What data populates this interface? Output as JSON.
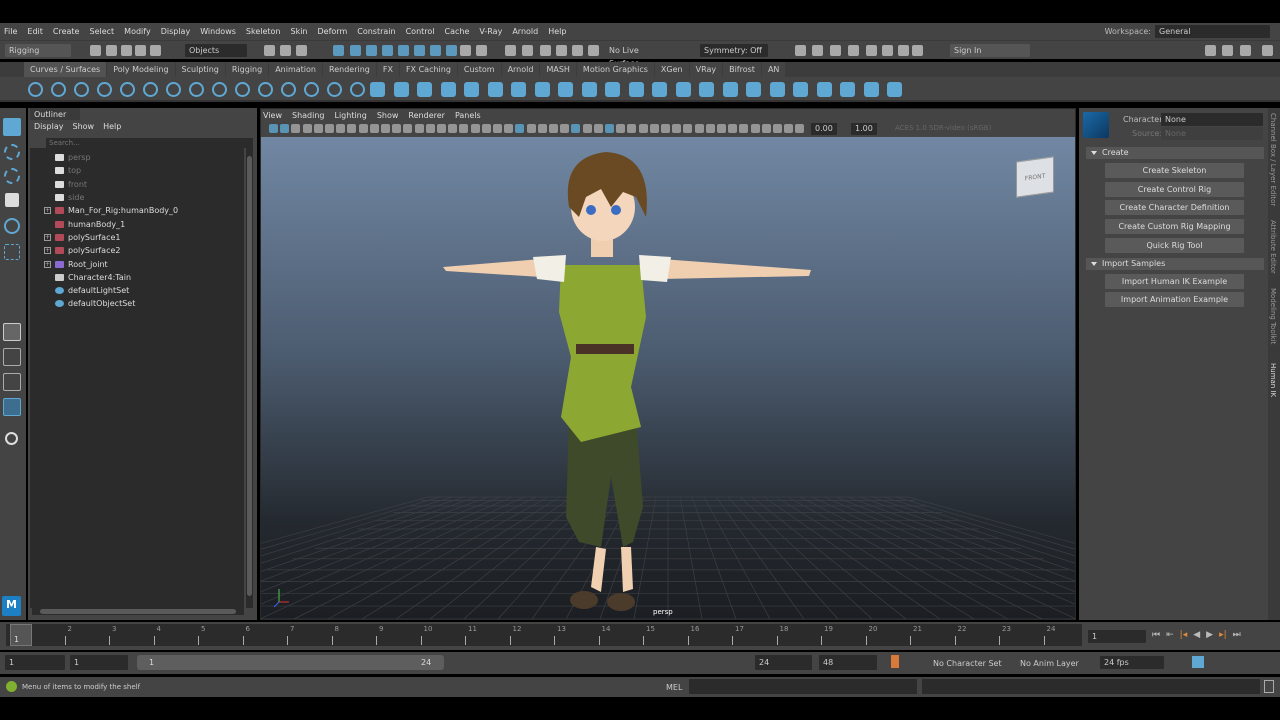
{
  "menubar": {
    "items": [
      "File",
      "Edit",
      "Create",
      "Select",
      "Modify",
      "Display",
      "Windows",
      "Skeleton",
      "Skin",
      "Deform",
      "Constrain",
      "Control",
      "Cache",
      "V-Ray",
      "Arnold",
      "Help"
    ],
    "workspace_label": "Workspace:",
    "workspace_value": "General"
  },
  "status": {
    "menuset": "Rigging",
    "selection_mode": "Objects",
    "live_surface": "No Live Surface",
    "symmetry": "Symmetry: Off",
    "sign_in": "Sign In"
  },
  "shelf": {
    "tabs": [
      "Curves / Surfaces",
      "Poly Modeling",
      "Sculpting",
      "Rigging",
      "Animation",
      "Rendering",
      "FX",
      "FX Caching",
      "Custom",
      "Arnold",
      "MASH",
      "Motion Graphics",
      "XGen",
      "VRay",
      "Bifrost",
      "AN"
    ],
    "active": 0
  },
  "outliner": {
    "title": "Outliner",
    "menu": [
      "Display",
      "Show",
      "Help"
    ],
    "search_placeholder": "Search...",
    "items": [
      {
        "label": "persp",
        "icon": "camera-icon",
        "dim": true,
        "expand": false
      },
      {
        "label": "top",
        "icon": "camera-icon",
        "dim": true,
        "expand": false
      },
      {
        "label": "front",
        "icon": "camera-icon",
        "dim": true,
        "expand": false
      },
      {
        "label": "side",
        "icon": "camera-icon",
        "dim": true,
        "expand": false
      },
      {
        "label": "Man_For_Rig:humanBody_0",
        "icon": "mesh-icon",
        "dim": false,
        "expand": true
      },
      {
        "label": "humanBody_1",
        "icon": "mesh-icon",
        "dim": false,
        "expand": false
      },
      {
        "label": "polySurface1",
        "icon": "mesh-icon",
        "dim": false,
        "expand": true
      },
      {
        "label": "polySurface2",
        "icon": "mesh-icon",
        "dim": false,
        "expand": true
      },
      {
        "label": "Root_joint",
        "icon": "joint-icon",
        "dim": false,
        "expand": true
      },
      {
        "label": "Character4:Tain",
        "icon": "character-icon",
        "dim": false,
        "expand": false
      },
      {
        "label": "defaultLightSet",
        "icon": "set-icon",
        "dim": false,
        "expand": false
      },
      {
        "label": "defaultObjectSet",
        "icon": "set-icon",
        "dim": false,
        "expand": false
      }
    ]
  },
  "viewport": {
    "menu": [
      "View",
      "Shading",
      "Lighting",
      "Show",
      "Renderer",
      "Panels"
    ],
    "exposure": "0.00",
    "gamma": "1.00",
    "color_space": "ACES 1.0 SDR-video (sRGB)",
    "camera_label": "persp",
    "viewcube_label": "FRONT"
  },
  "humanik": {
    "character_label": "Character:",
    "character_value": "None",
    "source_label": "Source:",
    "source_value": "None",
    "sections": [
      {
        "title": "Create",
        "buttons": [
          "Create Skeleton",
          "Create Control Rig",
          "Create Character Definition",
          "Create Custom Rig Mapping",
          "Quick Rig Tool"
        ]
      },
      {
        "title": "Import Samples",
        "buttons": [
          "Import Human IK Example",
          "Import Animation Example"
        ]
      }
    ]
  },
  "side_tabs": [
    "Channel Box / Layer Editor",
    "Attribute Editor",
    "Modeling Toolkit",
    "Human IK"
  ],
  "timeline": {
    "ticks": [
      "1",
      "2",
      "3",
      "4",
      "5",
      "6",
      "7",
      "8",
      "9",
      "10",
      "11",
      "12",
      "13",
      "14",
      "15",
      "16",
      "17",
      "18",
      "19",
      "20",
      "21",
      "22",
      "23",
      "24"
    ],
    "current_frame": "1"
  },
  "range": {
    "start": "1",
    "playback_start": "1",
    "slider_start": "1",
    "slider_end": "24",
    "playback_end": "24",
    "end": "48",
    "character_set": "No Character Set",
    "anim_layer": "No Anim Layer",
    "fps": "24 fps"
  },
  "helpline": {
    "message": "Menu of items to modify the shelf",
    "script_lang": "MEL"
  },
  "colors": {
    "accent": "#5fa8d3",
    "panel": "#444444",
    "field": "#2b2b2b"
  }
}
